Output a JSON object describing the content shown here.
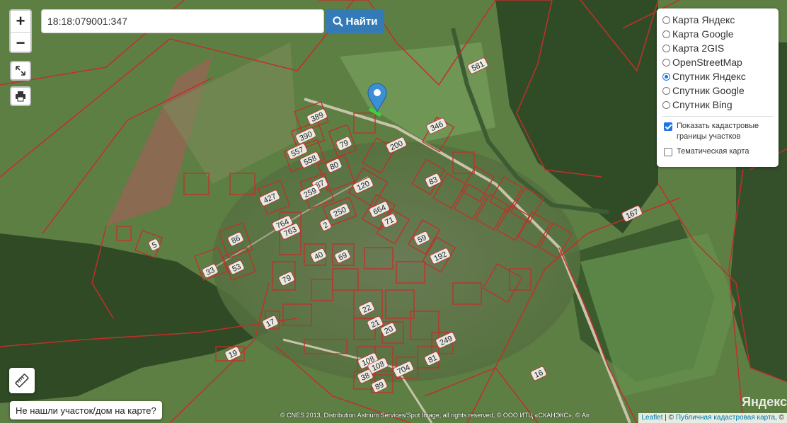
{
  "search": {
    "value": "18:18:079001:347",
    "button_label": "Найти"
  },
  "zoom": {
    "in_label": "+",
    "out_label": "−"
  },
  "layers": {
    "base_options": [
      {
        "label": "Карта Яндекс",
        "selected": false
      },
      {
        "label": "Карта Google",
        "selected": false
      },
      {
        "label": "Карта 2GIS",
        "selected": false
      },
      {
        "label": "OpenStreetMap",
        "selected": false
      },
      {
        "label": "Спутник Яндекс",
        "selected": true
      },
      {
        "label": "Спутник Google",
        "selected": false
      },
      {
        "label": "Спутник Bing",
        "selected": false
      }
    ],
    "overlays": [
      {
        "label": "Показать кадастровые границы участков",
        "checked": true
      },
      {
        "label": "Тематическая карта",
        "checked": false
      }
    ]
  },
  "not_found_button": "Не нашли участок/дом на карте?",
  "attribution": "© CNES 2013, Distribution Astrium Services/Spot Image, all rights reserved, © ООО ИТЦ «СКАНЭКС», © Air",
  "leaflet_attr": {
    "leaflet": "Leaflet",
    "separator": " | © ",
    "cadastral": "Публичная кадастровая карта",
    "suffix": ", ©"
  },
  "yandex_logo": "Яндекс",
  "plot_labels": [
    "389",
    "390",
    "557",
    "558",
    "79",
    "200",
    "346",
    "80",
    "87",
    "120",
    "259",
    "427",
    "250",
    "664",
    "71",
    "2",
    "83",
    "764",
    "763",
    "86",
    "5",
    "40",
    "69",
    "59",
    "192",
    "33",
    "53",
    "79",
    "167",
    "581",
    "22",
    "21",
    "20",
    "249",
    "17",
    "19",
    "108",
    "108",
    "81",
    "704",
    "38",
    "89",
    "16"
  ],
  "colors": {
    "boundary": "#c0302a",
    "search_button": "#337ab7",
    "radio_selected": "#1a73e8"
  },
  "icons": [
    "zoom-in-icon",
    "zoom-out-icon",
    "fullscreen-icon",
    "print-icon",
    "search-icon",
    "ruler-icon",
    "map-pin-icon"
  ]
}
